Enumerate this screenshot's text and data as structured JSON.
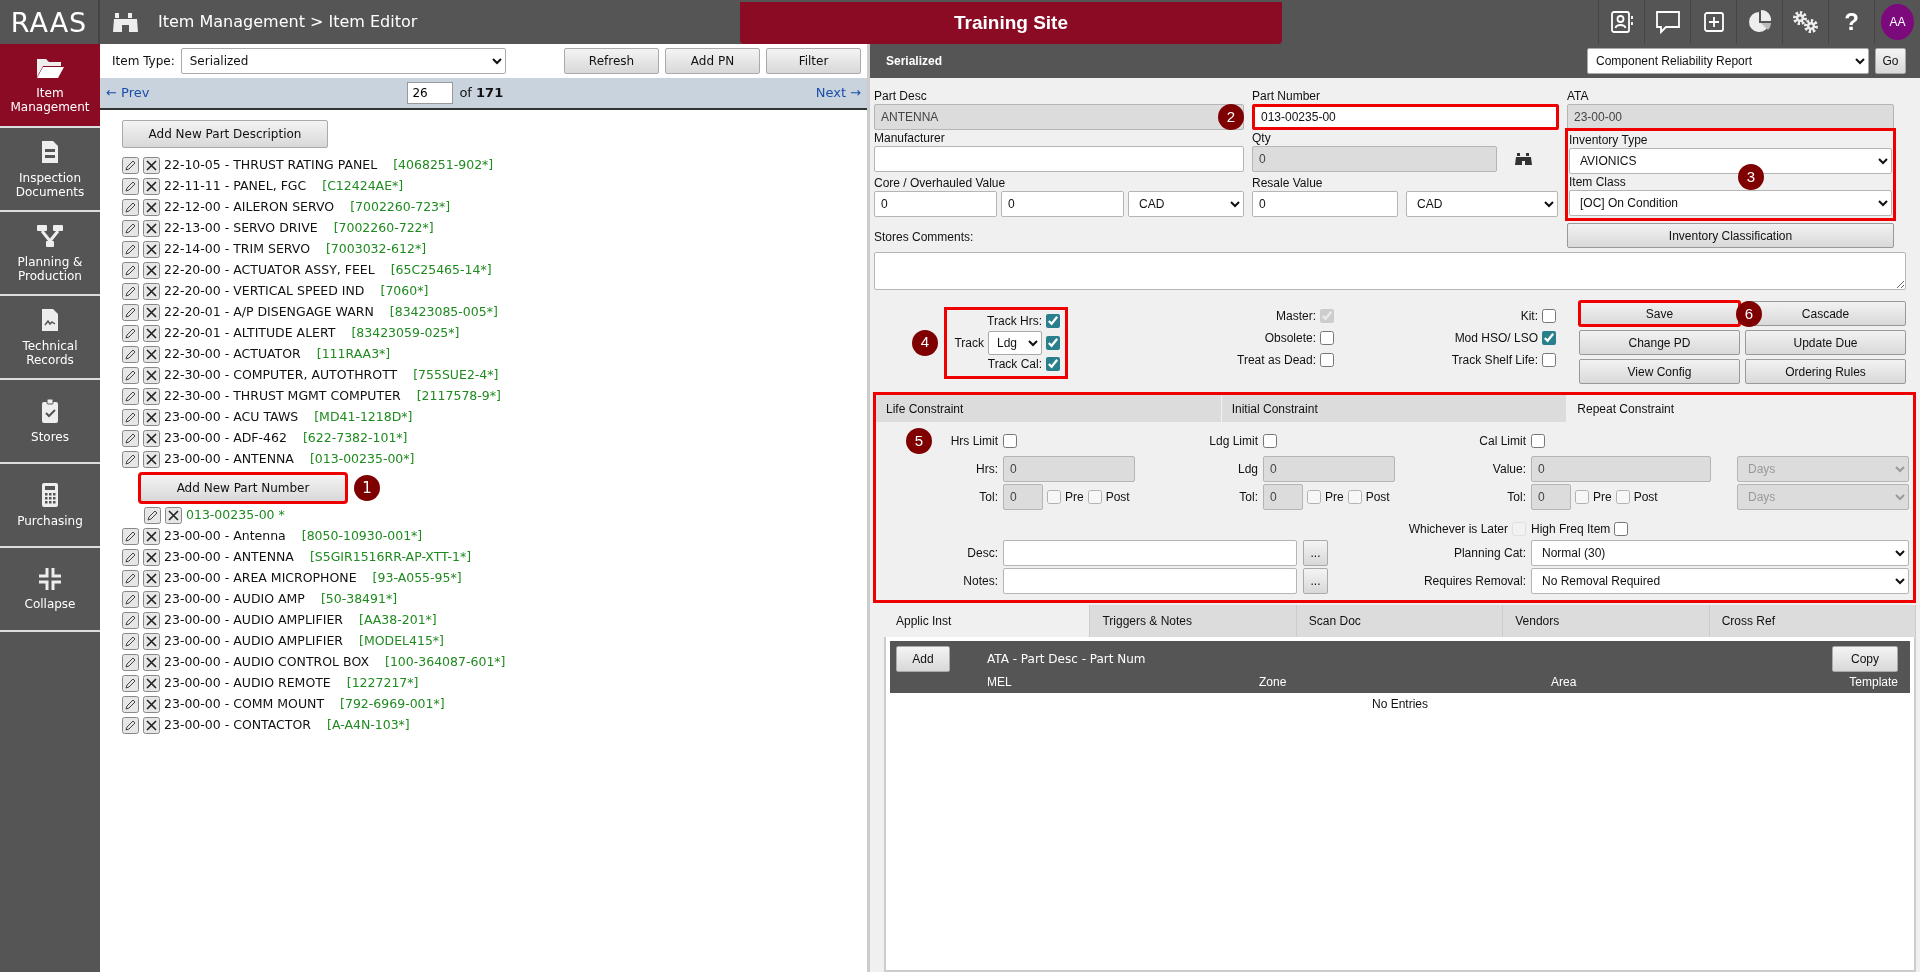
{
  "header": {
    "logo": "RAAS",
    "breadcrumb": "Item Management > Item Editor",
    "site": "Training Site",
    "help": "?",
    "avatar": "AA"
  },
  "sidebar": {
    "items": [
      {
        "label": "Item Management",
        "selected": true
      },
      {
        "label": "Inspection Documents",
        "selected": false
      },
      {
        "label": "Planning & Production",
        "selected": false
      },
      {
        "label": "Technical Records",
        "selected": false
      },
      {
        "label": "Stores",
        "selected": false
      },
      {
        "label": "Purchasing",
        "selected": false
      },
      {
        "label": "Collapse",
        "selected": false
      }
    ]
  },
  "list_panel": {
    "item_type": {
      "label": "Item Type:",
      "value": "Serialized"
    },
    "buttons": [
      "Refresh",
      "Add PN",
      "Filter"
    ],
    "pager": {
      "prev": "← Prev",
      "page": "26",
      "total": "of **171**",
      "next": "Next →"
    },
    "add_description_button": "Add New Part Description",
    "parts": [
      {
        "text": "22-10-05 - THRUST RATING PANEL",
        "pn": "[4068251-902*]"
      },
      {
        "text": "22-11-11 - PANEL, FGC",
        "pn": "[C12424AE*]"
      },
      {
        "text": "22-12-00 - AILERON SERVO",
        "pn": "[7002260-723*]"
      },
      {
        "text": "22-13-00 - SERVO DRIVE",
        "pn": "[7002260-722*]"
      },
      {
        "text": "22-14-00 - TRIM SERVO",
        "pn": "[7003032-612*]"
      },
      {
        "text": "22-20-00 - ACTUATOR ASSY, FEEL",
        "pn": "[65C25465-14*]"
      },
      {
        "text": "22-20-00 - VERTICAL SPEED IND",
        "pn": "[7060*]"
      },
      {
        "text": "22-20-01 - A/P DISENGAGE WARN",
        "pn": "[83423085-005*]"
      },
      {
        "text": "22-20-01 - ALTITUDE ALERT",
        "pn": "[83423059-025*]"
      },
      {
        "text": "22-30-00 - ACTUATOR",
        "pn": "[111RAA3*]"
      },
      {
        "text": "22-30-00 - COMPUTER, AUTOTHROTT",
        "pn": "[755SUE2-4*]"
      },
      {
        "text": "22-30-00 - THRUST MGMT COMPUTER",
        "pn": "[2117578-9*]"
      },
      {
        "text": "23-00-00 - ACU TAWS",
        "pn": "[MD41-1218D*]"
      },
      {
        "text": "23-00-00 - ADF-462",
        "pn": "[622-7382-101*]"
      },
      {
        "text": "23-00-00 - ANTENNA",
        "pn": "[013-00235-00*]",
        "add_button": {
          "label": "Add New Part Number",
          "highlighted": true,
          "callout": "1"
        },
        "part_numbers": [
          "013-00235-00 *"
        ]
      },
      {
        "text": "23-00-00 - Antenna",
        "pn": "[8050-10930-001*]"
      },
      {
        "text": "23-00-00 - ANTENNA",
        "pn": "[S5GIR1516RR-AP-XTT-1*]"
      },
      {
        "text": "23-00-00 - AREA MICROPHONE",
        "pn": "[93-A055-95*]"
      },
      {
        "text": "23-00-00 - AUDIO AMP",
        "pn": "[50-38491*]"
      },
      {
        "text": "23-00-00 - AUDIO AMPLIFIER",
        "pn": "[AA38-201*]"
      },
      {
        "text": "23-00-00 - AUDIO AMPLIFIER",
        "pn": "[MODEL415*]"
      },
      {
        "text": "23-00-00 - AUDIO CONTROL BOX",
        "pn": "[100-364087-601*]"
      },
      {
        "text": "23-00-00 - AUDIO REMOTE",
        "pn": "[1227217*]"
      },
      {
        "text": "23-00-00 - COMM MOUNT",
        "pn": "[792-6969-001*]"
      },
      {
        "text": "23-00-00 - CONTACTOR",
        "pn": "[A-A4N-103*]"
      }
    ]
  },
  "editor": {
    "title": "Serialized",
    "report": "Component Reliability Report",
    "go": "Go",
    "part_desc": {
      "label": "Part Desc",
      "value": "ANTENNA",
      "disabled": true
    },
    "part_number": {
      "label": "Part Number",
      "value": "013-00235-00",
      "highlighted": true,
      "callout": "2"
    },
    "ata": {
      "label": "ATA",
      "value": "23-00-00",
      "disabled": true
    },
    "manufacturer": {
      "label": "Manufacturer"
    },
    "qty": {
      "label": "Qty",
      "value": "0",
      "disabled": true
    },
    "core_value": {
      "label": "Core / Overhauled Value",
      "values": [
        "0",
        "0"
      ],
      "currency": "CAD"
    },
    "resale_value": {
      "label": "Resale Value",
      "value": "0",
      "currency": "CAD"
    },
    "classification": {
      "highlighted": true,
      "callout": "3",
      "inventory_type": {
        "label": "Inventory Type",
        "value": "AVIONICS"
      },
      "item_class": {
        "label": "Item Class",
        "value": "[OC] On Condition"
      }
    },
    "inventory_classification": "Inventory Classification",
    "stores_comments": {
      "label": "Stores Comments:"
    },
    "tracking": {
      "highlighted": true,
      "callout": "4",
      "track_hrs": {
        "label": "Track Hrs:",
        "checked": true
      },
      "track": {
        "label": "Track",
        "value": "Ldg",
        "checked": true
      },
      "track_cal": {
        "label": "Track Cal:",
        "checked": true
      }
    },
    "flags": [
      {
        "label": "Master:",
        "checked": true,
        "disabled": true
      },
      {
        "label": "Obsolete:",
        "checked": false,
        "disabled": false
      },
      {
        "label": "Treat as Dead:",
        "checked": false,
        "disabled": false
      },
      {
        "label": "Kit:",
        "checked": false,
        "disabled": false
      },
      {
        "label": "Mod HSO/ LSO",
        "checked": true,
        "disabled": false
      },
      {
        "label": "Track Shelf Life:",
        "checked": false,
        "disabled": false
      }
    ],
    "actions": [
      {
        "label": "Save",
        "highlighted": true,
        "callout": "6"
      },
      {
        "label": "Cascade",
        "highlighted": false
      },
      {
        "label": "Change PD",
        "highlighted": false
      },
      {
        "label": "Update Due",
        "highlighted": false
      },
      {
        "label": "View Config",
        "highlighted": false
      },
      {
        "label": "Ordering Rules",
        "highlighted": false
      }
    ],
    "constraints": {
      "highlighted": true,
      "callout": "5",
      "tabs": [
        {
          "label": "Life Constraint",
          "selected": false
        },
        {
          "label": "Initial Constraint",
          "selected": false
        },
        {
          "label": "Repeat Constraint",
          "selected": true
        }
      ],
      "limits": [
        {
          "label": "Hrs Limit",
          "checked": false,
          "value_label": "Hrs:",
          "value": "0",
          "tol_label": "Tol:",
          "tol": "0",
          "pre": "Pre",
          "pre_checked": false,
          "post": "Post",
          "post_checked": false
        },
        {
          "label": "Ldg Limit",
          "checked": false,
          "value_label": "Ldg",
          "value": "0",
          "tol_label": "Tol:",
          "tol": "0",
          "pre": "Pre",
          "pre_checked": false,
          "post": "Post",
          "post_checked": false
        },
        {
          "label": "Cal Limit",
          "checked": false,
          "value_label": "Value:",
          "value": "0",
          "unit": "Days",
          "tol_label": "Tol:",
          "tol": "0",
          "pre": "Pre",
          "pre_checked": false,
          "post": "Post",
          "post_checked": false,
          "tol_unit": "Days"
        }
      ],
      "whichever": {
        "label": "Whichever is Later",
        "checked": false,
        "disabled": true
      },
      "high_freq": {
        "label": "High Freq Item",
        "checked": false
      },
      "desc": {
        "label": "Desc:",
        "more": "..."
      },
      "notes": {
        "label": "Notes:",
        "more": "..."
      },
      "planning_cat": {
        "label": "Planning Cat:",
        "value": "Normal (30)"
      },
      "requires_removal": {
        "label": "Requires Removal:",
        "value": "No Removal Required"
      }
    },
    "bottom_tabs": [
      {
        "label": "Applic Inst",
        "selected": true
      },
      {
        "label": "Triggers & Notes",
        "selected": false
      },
      {
        "label": "Scan Doc",
        "selected": false
      },
      {
        "label": "Vendors",
        "selected": false
      },
      {
        "label": "Cross Ref",
        "selected": false
      }
    ],
    "applic_table": {
      "add": "Add",
      "title": "ATA - Part Desc - Part Num",
      "copy": "Copy",
      "columns": [
        "MEL",
        "Zone",
        "Area",
        "Template"
      ],
      "empty": "No Entries"
    }
  }
}
